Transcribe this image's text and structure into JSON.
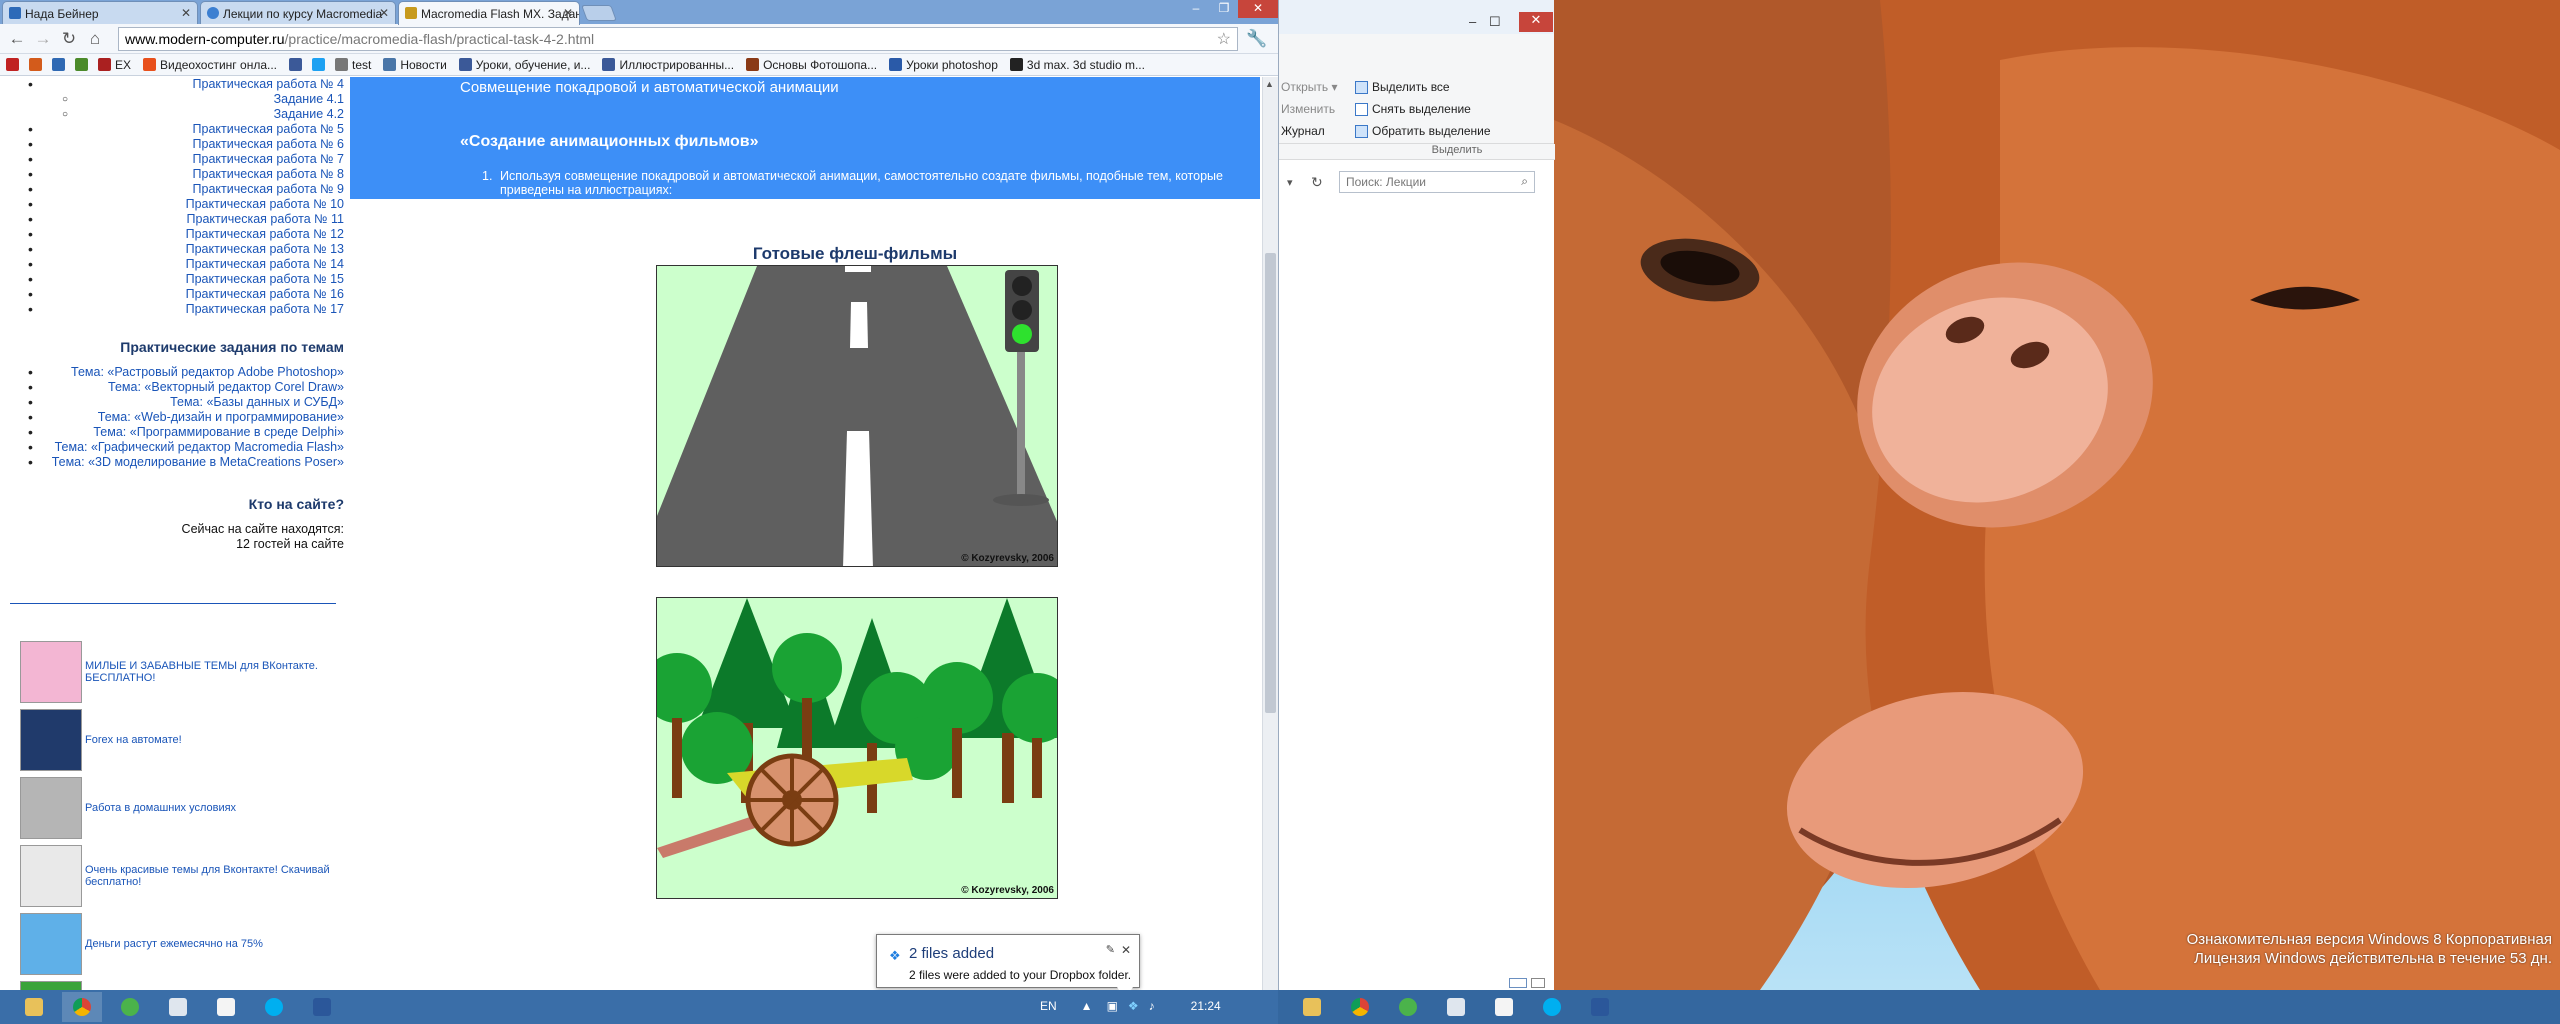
{
  "chrome": {
    "tabs": [
      {
        "label": "Нада Бейнер",
        "fav_color": "#2d6ab8"
      },
      {
        "label": "Лекции по курсу Macromedia",
        "fav_color": "#3c7fd1"
      },
      {
        "label": "Macromedia Flash MX. Задания",
        "fav_color": "#c79a1d"
      }
    ],
    "address": {
      "domain": "www.modern-computer.ru",
      "path": "/practice/macromedia-flash/practical-task-4-2.html"
    },
    "bookmarks": [
      {
        "label": "",
        "color": "#c02222"
      },
      {
        "label": "",
        "color": "#d35b1b"
      },
      {
        "label": "",
        "color": "#2f69b3"
      },
      {
        "label": "",
        "color": "#4b8a2a"
      },
      {
        "label": "EX",
        "color": "#aa2020"
      },
      {
        "label": "Видеохостинг онла...",
        "color": "#e8501c"
      },
      {
        "label": "",
        "color": "#3b5998"
      },
      {
        "label": "",
        "color": "#1da1f2"
      },
      {
        "label": "test",
        "color": "#777777"
      },
      {
        "label": "Новости",
        "color": "#4a76a8"
      },
      {
        "label": "Уроки, обучение, и...",
        "color": "#3b5998"
      },
      {
        "label": "Иллюстрированны...",
        "color": "#3b5998"
      },
      {
        "label": "Основы Фотошопа...",
        "color": "#8a3a16"
      },
      {
        "label": "Уроки photoshop",
        "color": "#2a5aa8"
      },
      {
        "label": "3d max. 3d studio m...",
        "color": "#222222"
      }
    ]
  },
  "page": {
    "practicals": [
      {
        "label": "Практическая работа № 4",
        "sub": false
      },
      {
        "label": "Задание 4.1",
        "sub": true
      },
      {
        "label": "Задание 4.2",
        "sub": true
      },
      {
        "label": "Практическая работа № 5",
        "sub": false
      },
      {
        "label": "Практическая работа № 6",
        "sub": false
      },
      {
        "label": "Практическая работа № 7",
        "sub": false
      },
      {
        "label": "Практическая работа № 8",
        "sub": false
      },
      {
        "label": "Практическая работа № 9",
        "sub": false
      },
      {
        "label": "Практическая работа № 10",
        "sub": false
      },
      {
        "label": "Практическая работа № 11",
        "sub": false
      },
      {
        "label": "Практическая работа № 12",
        "sub": false
      },
      {
        "label": "Практическая работа № 13",
        "sub": false
      },
      {
        "label": "Практическая работа № 14",
        "sub": false
      },
      {
        "label": "Практическая работа № 15",
        "sub": false
      },
      {
        "label": "Практическая работа № 16",
        "sub": false
      },
      {
        "label": "Практическая работа № 17",
        "sub": false
      }
    ],
    "themes_heading": "Практические задания по темам",
    "themes": [
      "Тема: «Растровый редактор Adobe Photoshop»",
      "Тема: «Векторный редактор Corel Draw»",
      "Тема: «Базы данных и СУБД»",
      "Тема: «Web-дизайн и программирование»",
      "Тема: «Программирование в среде Delphi»",
      "Тема: «Графический редактор Macromedia Flash»",
      "Тема: «3D моделирование в MetaCreations Poser»"
    ],
    "who_heading": "Кто на сайте?",
    "who_line1": "Сейчас на сайте находятся:",
    "who_line2": "12 гостей на сайте",
    "ads": [
      {
        "text": "МИЛЫЕ И ЗАБАВНЫЕ ТЕМЫ для ВКонтакте. БЕСПЛАТНО!",
        "color": "#f3b6d3"
      },
      {
        "text": "Forex на автомате!",
        "color": "#203a6b"
      },
      {
        "text": "Работа в домашних условиях",
        "color": "#b5b5b5"
      },
      {
        "text": "Очень красивые темы для Вконтакте! Скачивай бесплатно!",
        "color": "#e9e9e9"
      },
      {
        "text": "Деньги растут ежемесячно на 75%",
        "color": "#5fb0e8"
      },
      {
        "text": "",
        "color": "#3aa33a"
      }
    ],
    "banner": {
      "line1": "Совмещение покадровой и автоматической анимации",
      "heading": "«Создание анимационных фильмов»",
      "item_num": "1.",
      "item_text": "Используя совмещение покадровой и автоматической анимации, самостоятельно создате фильмы, подобные тем, которые приведены на иллюстрациях:"
    },
    "films_heading": "Готовые флеш-фильмы",
    "copyright": "© Kozyrevsky, 2006"
  },
  "explorer": {
    "ribbon": {
      "open": "Открыть",
      "edit": "Изменить",
      "journal": "Журнал",
      "select_all": "Выделить все",
      "deselect": "Снять выделение",
      "invert": "Обратить выделение",
      "group_label": "Выделить"
    },
    "search_placeholder": "Поиск: Лекции"
  },
  "dropbox": {
    "title": "2 files added",
    "message": "2 files were added to your Dropbox folder."
  },
  "tray": {
    "lang": "EN",
    "time": "21:24"
  },
  "desktop": {
    "eval_line1": "Ознакомительная версия Windows 8 Корпоративная",
    "eval_line2": "Лицензия Windows действительна в течение 53 дн."
  }
}
